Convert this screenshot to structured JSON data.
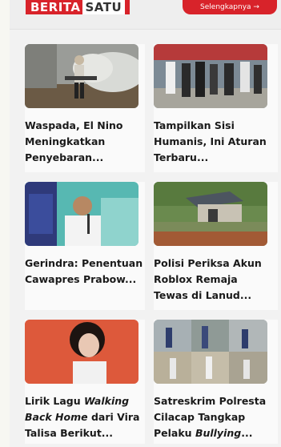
{
  "header": {
    "brand_left": "BERITA",
    "brand_right": "SATU",
    "cta_label": "Selengkapnya →"
  },
  "articles": [
    {
      "title": "Waspada, El Nino Meningkatkan Penyebaran..."
    },
    {
      "title": "Tampilkan Sisi Humanis, Ini Aturan Terbaru..."
    },
    {
      "title": "Gerindra: Penentuan Cawapres Prabow..."
    },
    {
      "title": "Polisi Periksa Akun Roblox Remaja Tewas di Lanud..."
    },
    {
      "title_pre": "Lirik Lagu ",
      "title_italic": "Walking Back Home",
      "title_post": " dari Vira Talisa Berikut..."
    },
    {
      "title_pre": "Satreskrim Polresta Cilacap Tangkap Pelaku ",
      "title_italic": "Bullying",
      "title_post": "..."
    }
  ]
}
